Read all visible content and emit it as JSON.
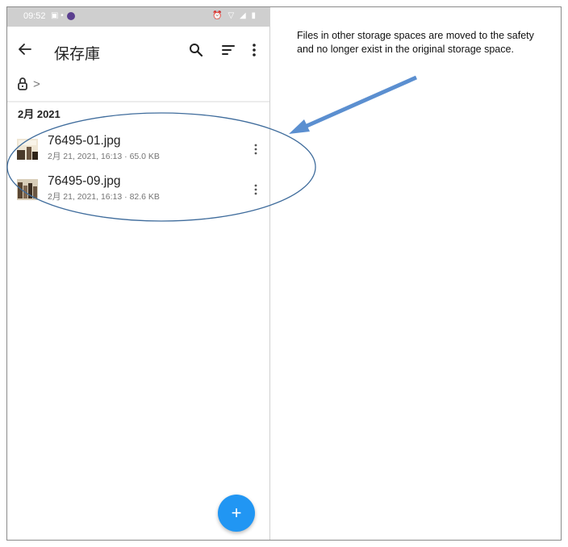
{
  "status_bar": {
    "time": "09:52",
    "left_icons": "▣ •",
    "right_icons": "⏰ ▽ ◢ ▮"
  },
  "toolbar": {
    "title": "保存庫",
    "back_icon": "arrow-left",
    "search_icon": "search",
    "sort_icon": "sort",
    "more_icon": "more-vertical"
  },
  "breadcrumb": {
    "lock_icon": "lock",
    "separator": ">"
  },
  "section": {
    "header": "2月 2021"
  },
  "files": [
    {
      "name": "76495-01.jpg",
      "meta": "2月 21, 2021, 16:13 · 65.0 KB"
    },
    {
      "name": "76495-09.jpg",
      "meta": "2月 21, 2021, 16:13 · 82.6 KB"
    }
  ],
  "fab": {
    "label": "+",
    "color": "#2196f3"
  },
  "annotation": {
    "text": "Files in other storage spaces are moved to the safety and no longer exist in the original storage space.",
    "color": "#5b8fd0"
  }
}
